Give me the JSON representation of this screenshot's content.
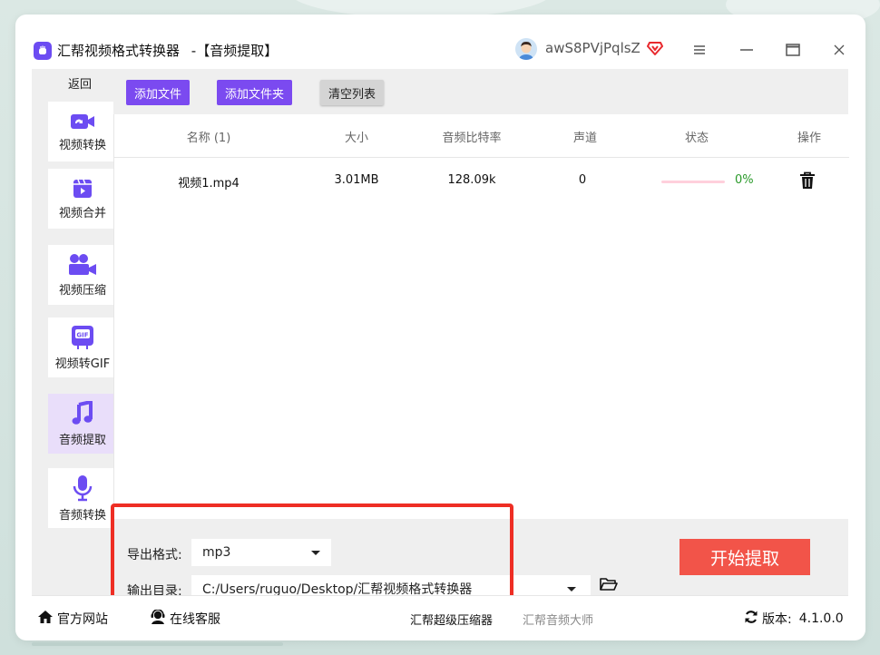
{
  "window": {
    "app_name": "汇帮视频格式转换器",
    "page_name": "-【音频提取】",
    "username": "awS8PVjPqlsZ"
  },
  "sidebar": {
    "back_label": "返回",
    "items": [
      {
        "label": "视频转换",
        "icon": "video-convert-icon"
      },
      {
        "label": "视频合并",
        "icon": "video-merge-icon"
      },
      {
        "label": "视频压缩",
        "icon": "video-compress-icon"
      },
      {
        "label": "视频转GIF",
        "icon": "gif-icon"
      },
      {
        "label": "音频提取",
        "icon": "music-note-icon",
        "active": true
      },
      {
        "label": "音频转换",
        "icon": "microphone-icon"
      }
    ]
  },
  "toolbar": {
    "add_file": "添加文件",
    "add_folder": "添加文件夹",
    "clear_list": "清空列表"
  },
  "table": {
    "headers": [
      "名称 (1)",
      "大小",
      "音频比特率",
      "声道",
      "状态",
      "操作"
    ],
    "rows": [
      {
        "name": "视频1.mp4",
        "size": "3.01MB",
        "bitrate": "128.09k",
        "channels": "0",
        "progress": "0%",
        "progress_fraction": 0
      }
    ]
  },
  "settings": {
    "format_label": "导出格式:",
    "format_value": "mp3",
    "output_label": "输出目录:",
    "output_value": "C:/Users/ruguo/Desktop/汇帮视频格式转换器",
    "start_button": "开始提取"
  },
  "footer": {
    "website": "官方网站",
    "support": "在线客服",
    "link_1": "汇帮超级压缩器",
    "link_2": "汇帮音频大师",
    "version_label": "版本:",
    "version": "4.1.0.0"
  },
  "colors": {
    "accent_purple": "#7b4af0",
    "active_nav_bg": "#e9defa",
    "start_button": "#f25449",
    "progress_text": "#2a9a2a",
    "highlight_box": "#ee2e24"
  }
}
